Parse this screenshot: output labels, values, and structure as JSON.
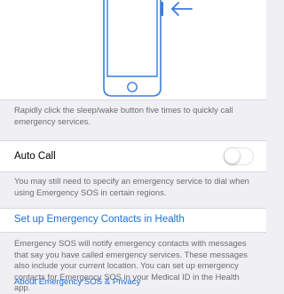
{
  "instructions": {
    "rapid_click": "Rapidly click the sleep/wake button five times to quickly call emergency services."
  },
  "auto_call": {
    "label": "Auto Call",
    "enabled": false,
    "note": "You may still need to specify an emergency service to dial when using Emergency SOS in certain regions."
  },
  "contacts": {
    "link_label": "Set up Emergency Contacts in Health",
    "description": "Emergency SOS will notify emergency contacts with messages that say you have called emergency services. These messages also include your current location. You can set up emergency contacts for Emergency SOS in your Medical ID in the Health app.",
    "about_link": "About Emergency SOS & Privacy"
  },
  "icons": {
    "phone": "phone-outline-icon",
    "arrow": "arrow-left-icon"
  },
  "colors": {
    "accent": "#1e6fd9",
    "background": "#efeff4",
    "footer_text": "#6d6d72"
  }
}
